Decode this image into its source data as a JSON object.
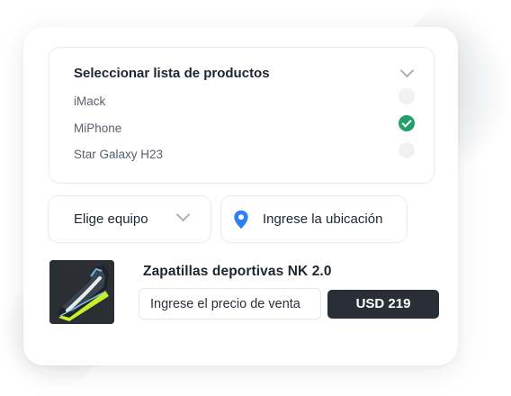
{
  "product_list": {
    "title": "Seleccionar lista de productos",
    "options": [
      {
        "label": "iMack",
        "selected": false
      },
      {
        "label": "MiPhone",
        "selected": true
      },
      {
        "label": "Star Galaxy H23",
        "selected": false
      }
    ]
  },
  "team_select": {
    "label": "Elige equipo"
  },
  "location": {
    "label": "Ingrese la ubicación",
    "icon": "location-pin-icon"
  },
  "product": {
    "title": "Zapatillas deportivas NK 2.0",
    "image_icon": "sneaker-icon",
    "price_placeholder": "Ingrese el precio de venta",
    "price_button": "USD 219"
  },
  "colors": {
    "accent_green": "#22a06b",
    "pin_blue": "#2f7ff0",
    "button_dark": "#2a2f37",
    "shoe_neon": "#c6f02a"
  }
}
